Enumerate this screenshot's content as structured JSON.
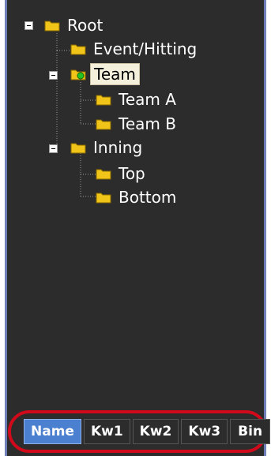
{
  "tree": {
    "nodes": [
      {
        "id": "root",
        "label": "Root",
        "icon": "folder-icon"
      },
      {
        "id": "event-hitting",
        "label": "Event/Hitting",
        "icon": "folder-icon"
      },
      {
        "id": "team",
        "label": "Team",
        "icon": "folder-active-icon",
        "selected": true
      },
      {
        "id": "team-a",
        "label": "Team A",
        "icon": "folder-icon"
      },
      {
        "id": "team-b",
        "label": "Team B",
        "icon": "folder-icon"
      },
      {
        "id": "inning",
        "label": "Inning",
        "icon": "folder-icon"
      },
      {
        "id": "top",
        "label": "Top",
        "icon": "folder-icon"
      },
      {
        "id": "bottom",
        "label": "Bottom",
        "icon": "folder-icon"
      }
    ]
  },
  "tabs": [
    {
      "label": "Name",
      "active": true
    },
    {
      "label": "Kw1",
      "active": false
    },
    {
      "label": "Kw2",
      "active": false
    },
    {
      "label": "Kw3",
      "active": false
    },
    {
      "label": "Bin",
      "active": false
    }
  ],
  "colors": {
    "panel_bg": "#2c2c2c",
    "panel_border": "#6f7fb8",
    "active_tab": "#4b7fd0",
    "highlight_ring": "#d00a1a",
    "selected_node_bg": "#f4f0dc",
    "folder": "#f0c419"
  }
}
